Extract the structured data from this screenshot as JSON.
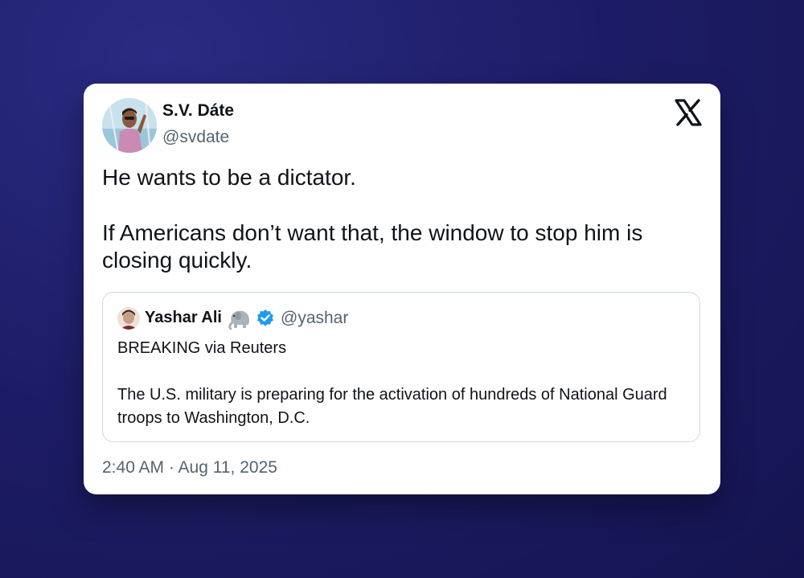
{
  "author": {
    "name": "S.V. Dáte",
    "handle": "@svdate"
  },
  "brand_icon": "x-logo-icon",
  "tweet": {
    "paragraphs": [
      "He wants to be a dictator.",
      "If Americans don’t want that, the window to stop him is closing quickly."
    ]
  },
  "quoted_tweet": {
    "author_name": "Yashar Ali",
    "emoji_icon": "elephant-icon",
    "badge_icon": "verified-badge-icon",
    "handle": "@yashar",
    "paragraphs": [
      "BREAKING via Reuters",
      "The U.S. military is preparing for the activation of hundreds of National Guard troops to Washington, D.C."
    ]
  },
  "timestamp": "2:40 AM · Aug 11, 2025",
  "colors": {
    "background": "#1d1d68",
    "card": "#ffffff",
    "text_primary": "#0f1419",
    "text_secondary": "#536471",
    "border": "#cfd9de",
    "verified": "#1d9bf0"
  }
}
